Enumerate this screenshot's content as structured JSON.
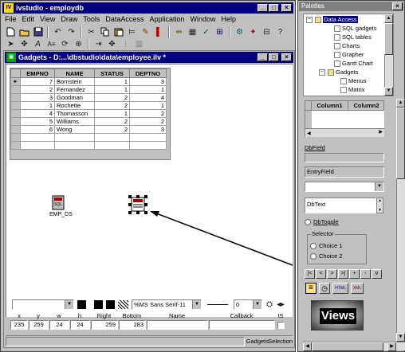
{
  "main_window": {
    "title": "ivstudio - employdb",
    "app_icon": "IV",
    "buttons": {
      "minimize": "_",
      "maximize": "□",
      "close": "×"
    }
  },
  "menu": [
    "File",
    "Edit",
    "View",
    "Draw",
    "Tools",
    "DataAccess",
    "Application",
    "Window",
    "Help"
  ],
  "toolbar1_icons": [
    "new-file-icon",
    "open-folder-icon",
    "save-icon",
    "undo-icon",
    "redo-icon",
    "cut-icon",
    "copy-icon",
    "paste-icon",
    "align-icon",
    "brush-icon",
    "flag-icon",
    "attach-icon",
    "grid-icon",
    "check-icon",
    "inspect-icon",
    "link-icon",
    "test-icon",
    "check2-icon",
    "layout-icon",
    "table-icon",
    "gear-icon",
    "help-icon"
  ],
  "toolbar2_icons": [
    "select-arrow-icon",
    "move-icon",
    "text-A-icon",
    "font-size-icon",
    "rotate-icon",
    "group-icon",
    "import-icon",
    "align-center-icon",
    "bars-icon",
    "chart-icon",
    "spin-icon"
  ],
  "gadgets_window": {
    "title": "Gadgets - D:...\\dbstudio\\data\\employee.ilv *",
    "table": {
      "columns": [
        "EMPNO",
        "NAME",
        "STATUS",
        "DEPTNO"
      ],
      "rows": [
        [
          "7",
          "Bornstein",
          "1",
          "3"
        ],
        [
          "2",
          "Fernandez",
          "1",
          "1"
        ],
        [
          "3",
          "Goodman",
          "2",
          "4"
        ],
        [
          "1",
          "Rochette",
          "2",
          "1"
        ],
        [
          "4",
          "Thomasson",
          "1",
          "2"
        ],
        [
          "5",
          "Williams",
          "2",
          "2"
        ],
        [
          "6",
          "Wong",
          "2",
          "3"
        ]
      ],
      "current_row_marker": "►"
    },
    "object_label": "EMP_DS",
    "font_combo": "%MS Sans Serif-11",
    "line_width": "0",
    "props": {
      "headers": [
        "x",
        "y",
        "w",
        "h",
        "Right",
        "Bottom",
        "Name",
        "Callback",
        "IS"
      ],
      "values": [
        "235",
        "259",
        "24",
        "24",
        "259",
        "283",
        "",
        "",
        ""
      ]
    },
    "status": [
      "Gadgets",
      "Selection"
    ]
  },
  "palettes": {
    "title": "Palettes",
    "tree": [
      {
        "label": "Data Access",
        "level": 0,
        "expander": "−",
        "selected": true
      },
      {
        "label": "SQL gadgets",
        "level": 2
      },
      {
        "label": "SQL tables",
        "level": 2
      },
      {
        "label": "Charts",
        "level": 2
      },
      {
        "label": "Grapher",
        "level": 2
      },
      {
        "label": "Gantt Chart",
        "level": 2
      },
      {
        "label": "Gadgets",
        "level": 1,
        "expander": "−"
      },
      {
        "label": "Menus",
        "level": 3
      },
      {
        "label": "Matrix",
        "level": 3
      }
    ],
    "matrix_columns": [
      "Column1",
      "Column2"
    ],
    "dbfield_label": "DbField",
    "entryfield_value": "EntryField",
    "dbtext_value": "DbText",
    "dbtoggle_label": "DbToggle",
    "selector": {
      "label": "Selector",
      "choices": [
        "Choice 1",
        "Choice 2"
      ]
    },
    "nav_buttons": [
      "|<",
      "<",
      ">",
      ">|",
      "+",
      "-",
      "v"
    ],
    "small_icons": [
      "tag-icon",
      "clock-icon",
      "html-icon",
      "xml-icon"
    ],
    "views_logo": "Views"
  }
}
